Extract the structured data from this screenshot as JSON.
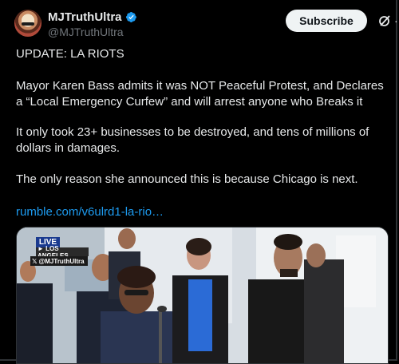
{
  "post": {
    "display_name": "MJTruthUltra",
    "handle": "@MJTruthUltra",
    "subscribe_label": "Subscribe",
    "text": {
      "line1": "UPDATE: LA RIOTS",
      "line2": "Mayor Karen Bass admits it was NOT Peaceful Protest, and Declares a “Local Emergency Curfew” and will arrest anyone who Breaks it",
      "line3": "It only took 23+ businesses to be destroyed, and tens of millions of dollars in damages.",
      "line4": "The only reason she announced this is because Chicago is next.",
      "link": "rumble.com/v6ulrd1-la-rio…"
    },
    "media": {
      "live_label": "LIVE",
      "location_label": "► LOS ANGELES",
      "watermark": "@MJTruthUltra"
    }
  },
  "icons": {
    "verified": "verified-badge-icon",
    "grok": "grok-icon",
    "more": "more-icon"
  },
  "colors": {
    "background": "#000000",
    "text": "#e7e9ea",
    "muted": "#71767b",
    "link": "#1d9bf0",
    "verified": "#1d9bf0",
    "subscribe_bg": "#eff3f4"
  }
}
